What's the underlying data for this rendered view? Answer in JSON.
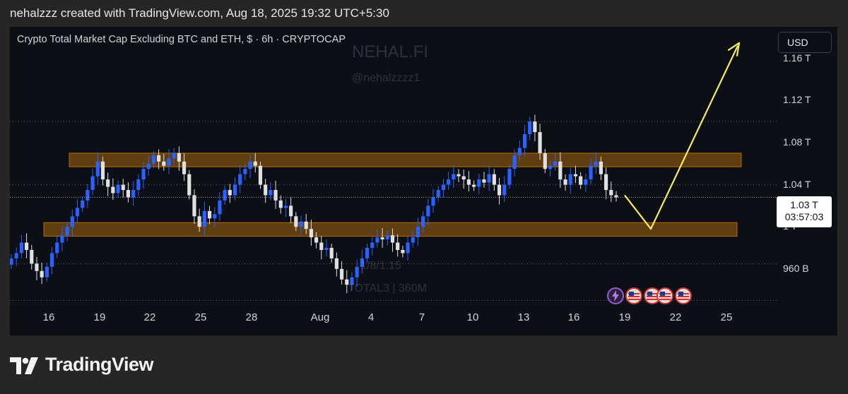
{
  "header": {
    "text": "nehalzzz created with TradingView.com, Aug 18, 2025 19:32 UTC+5:30"
  },
  "chart": {
    "title": "Crypto Total Market Cap Excluding BTC and ETH, $ · 6h · CRYPTOCAP",
    "currency_button": "USD",
    "watermark": {
      "brand": "NEHAL.FI",
      "handle": "@nehalzzzz1",
      "ratio": "1/8/1.15",
      "series": "TOTAL3 | 360M"
    },
    "last_price": "1.03 T",
    "countdown": "03:57:03",
    "colors": {
      "up": "#2962ff",
      "down": "#e0e0e0",
      "zone": "#ff9800",
      "arrow": "#f6eb61"
    }
  },
  "chart_data": {
    "type": "candlestick",
    "title": "Crypto Total Market Cap Excluding BTC and ETH, $ · 6h · CRYPTOCAP",
    "y_unit": "T",
    "y_ticks": [
      {
        "label": "1.16 T",
        "value": 1.16
      },
      {
        "label": "1.12 T",
        "value": 1.12
      },
      {
        "label": "1.08 T",
        "value": 1.08
      },
      {
        "label": "1.04 T",
        "value": 1.04
      },
      {
        "label": "1 T",
        "value": 1.0
      },
      {
        "label": "960 B",
        "value": 0.96
      }
    ],
    "x_ticks": [
      "16",
      "19",
      "22",
      "25",
      "28",
      "Aug",
      "4",
      "7",
      "10",
      "13",
      "16",
      "19",
      "22",
      "25"
    ],
    "ylim": [
      0.925,
      1.19
    ],
    "resistance_zone": [
      1.057,
      1.07
    ],
    "support_zone": [
      0.991,
      1.004
    ],
    "close_series": [
      0.97,
      0.975,
      0.985,
      0.978,
      0.965,
      0.958,
      0.952,
      0.962,
      0.975,
      0.985,
      0.992,
      1.0,
      1.01,
      1.018,
      1.025,
      1.035,
      1.048,
      1.062,
      1.045,
      1.038,
      1.032,
      1.04,
      1.035,
      1.028,
      1.035,
      1.045,
      1.055,
      1.06,
      1.068,
      1.062,
      1.058,
      1.065,
      1.07,
      1.062,
      1.05,
      1.03,
      1.01,
      1.0,
      1.015,
      1.008,
      1.012,
      1.025,
      1.035,
      1.03,
      1.04,
      1.05,
      1.055,
      1.062,
      1.058,
      1.04,
      1.03,
      1.035,
      1.025,
      1.018,
      1.02,
      1.01,
      1.0,
      1.005,
      0.998,
      0.99,
      0.985,
      0.978,
      0.98,
      0.97,
      0.96,
      0.95,
      0.945,
      0.952,
      0.962,
      0.97,
      0.98,
      0.985,
      0.99,
      0.988,
      0.992,
      0.985,
      0.978,
      0.975,
      0.985,
      0.99,
      1.0,
      1.01,
      1.02,
      1.028,
      1.035,
      1.04,
      1.045,
      1.05,
      1.048,
      1.045,
      1.04,
      1.038,
      1.045,
      1.042,
      1.05,
      1.04,
      1.03,
      1.04,
      1.055,
      1.068,
      1.075,
      1.088,
      1.1,
      1.09,
      1.07,
      1.055,
      1.058,
      1.062,
      1.045,
      1.04,
      1.05,
      1.048,
      1.04,
      1.045,
      1.058,
      1.062,
      1.05,
      1.035,
      1.03,
      1.028
    ],
    "projection": [
      {
        "x_label": "19",
        "value": 1.03
      },
      {
        "x_label": "20.6",
        "value": 0.998
      },
      {
        "x_label": "25.4",
        "value": 1.172
      }
    ]
  }
}
